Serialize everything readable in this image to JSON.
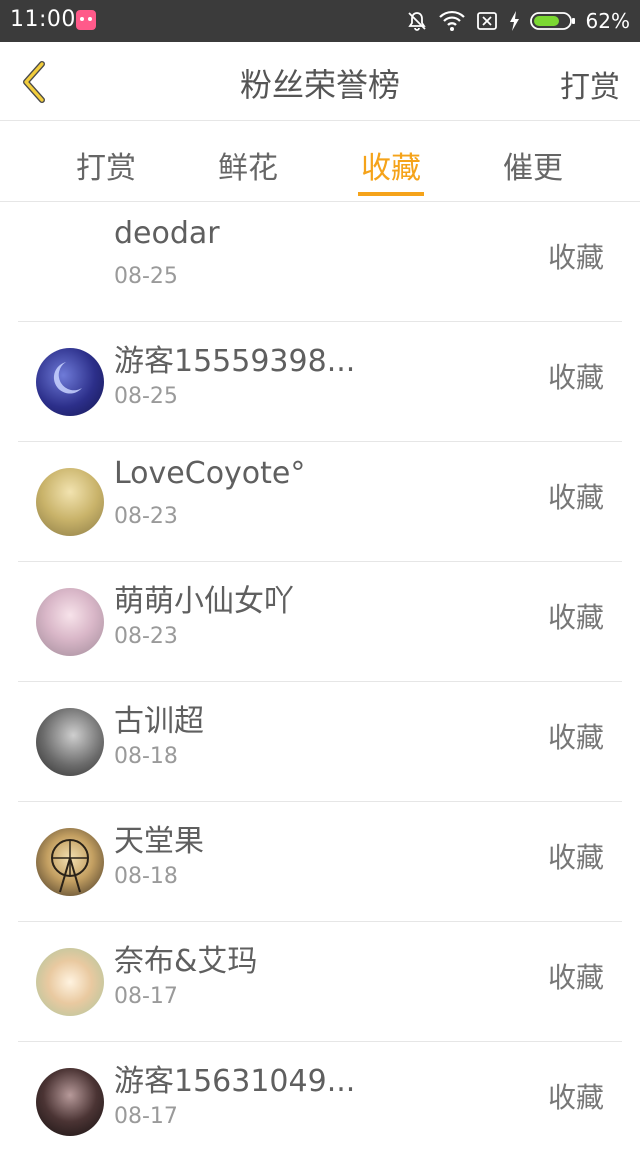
{
  "status_bar": {
    "time": "11:00",
    "battery_text": "62%",
    "icons": [
      "app-notification-icon",
      "mute-bell-icon",
      "wifi-icon",
      "sim-none-icon",
      "charging-icon",
      "battery-icon"
    ]
  },
  "navbar": {
    "back_icon": "back-chevron-icon",
    "title": "粉丝荣誉榜",
    "action": "打赏",
    "accent_color": "#f5a31a"
  },
  "tabs": [
    {
      "label": "打赏",
      "active": false
    },
    {
      "label": "鲜花",
      "active": false
    },
    {
      "label": "收藏",
      "active": true
    },
    {
      "label": "催更",
      "active": false
    }
  ],
  "list": [
    {
      "name": "deodar",
      "date": "08-25",
      "action": "收藏",
      "avatar": "none"
    },
    {
      "name": "游客15559398...",
      "date": "08-25",
      "action": "收藏",
      "avatar": "user-avatar"
    },
    {
      "name": "LoveCoyote°",
      "date": "08-23",
      "action": "收藏",
      "avatar": "user-avatar"
    },
    {
      "name": "萌萌小仙女吖",
      "date": "08-23",
      "action": "收藏",
      "avatar": "user-avatar"
    },
    {
      "name": "古训超",
      "date": "08-18",
      "action": "收藏",
      "avatar": "user-avatar"
    },
    {
      "name": "天堂果",
      "date": "08-18",
      "action": "收藏",
      "avatar": "user-avatar"
    },
    {
      "name": "奈布&艾玛",
      "date": "08-17",
      "action": "收藏",
      "avatar": "user-avatar"
    },
    {
      "name": "游客15631049...",
      "date": "08-17",
      "action": "收藏",
      "avatar": "user-avatar"
    }
  ]
}
